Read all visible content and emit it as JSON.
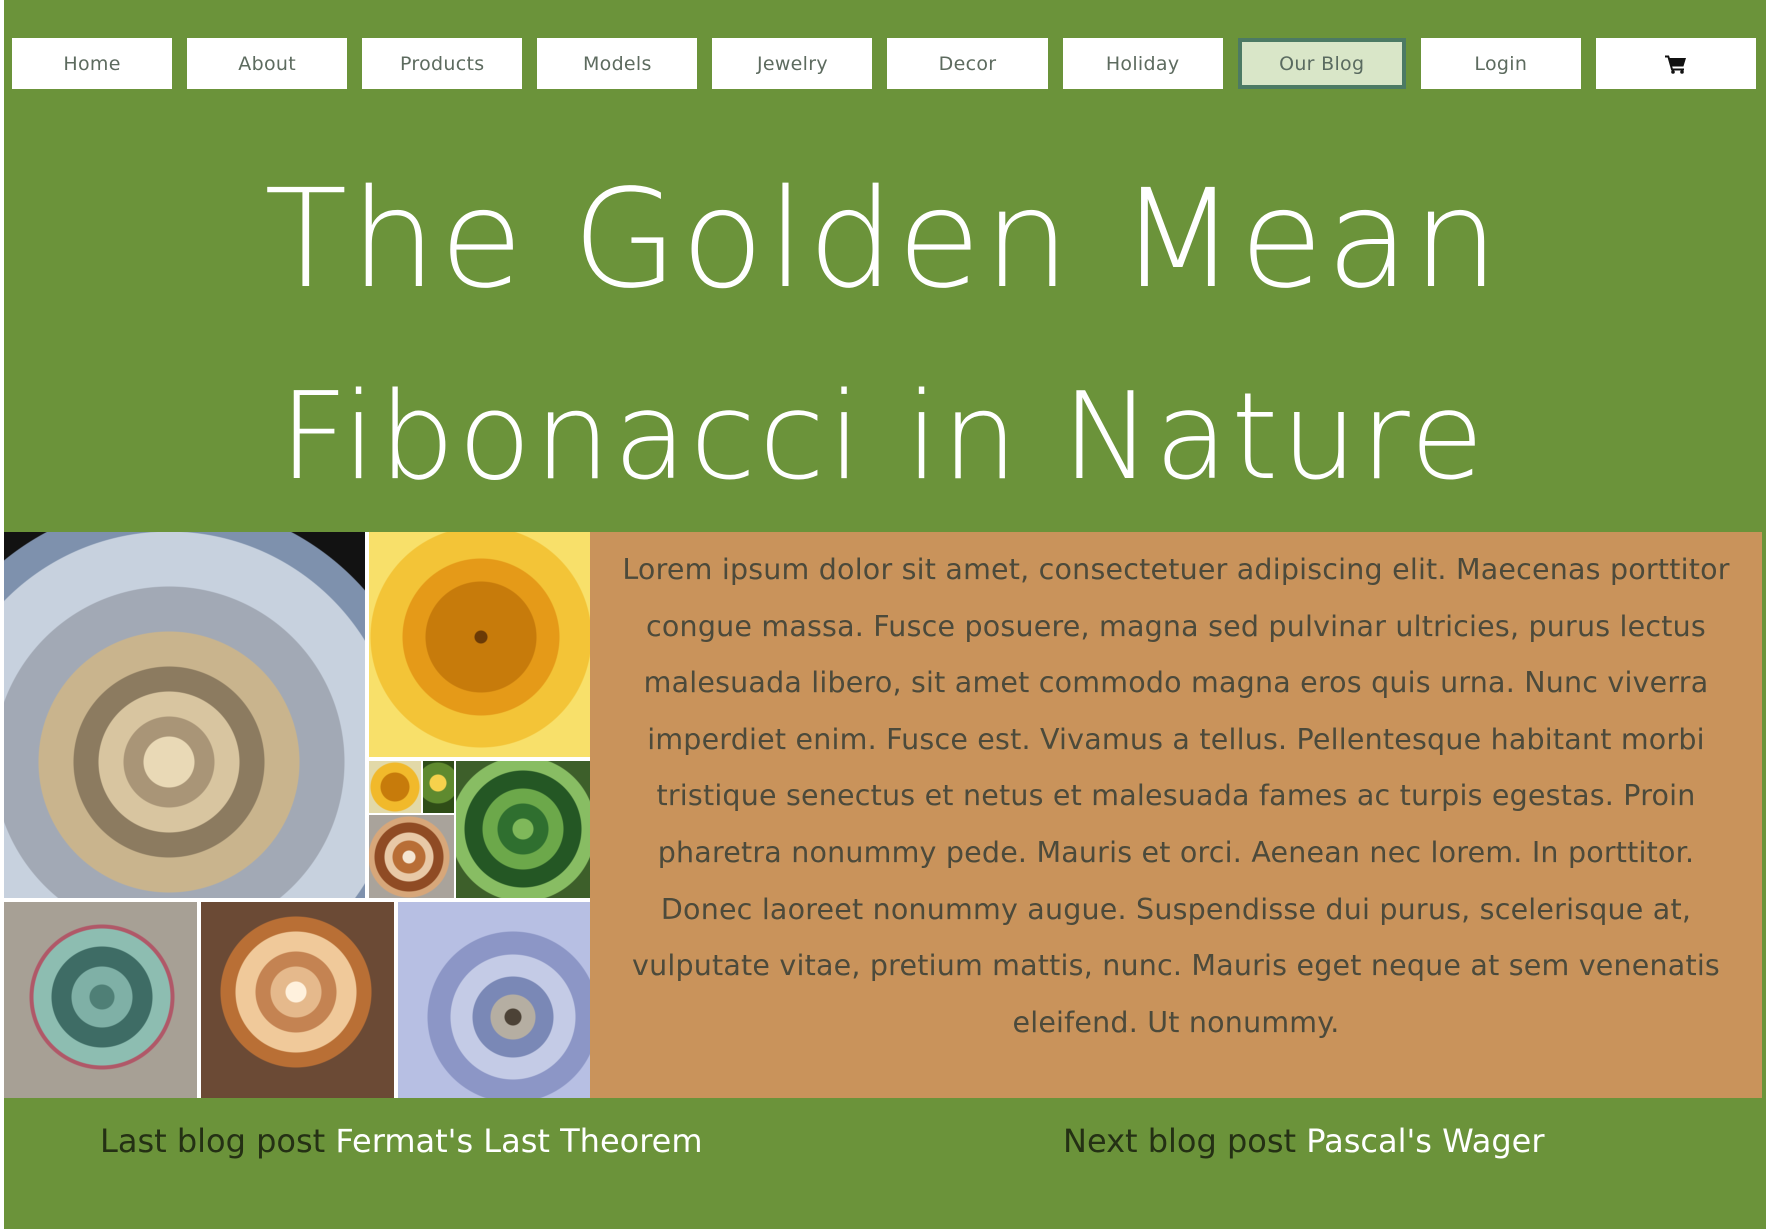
{
  "nav": {
    "items": [
      {
        "label": "Home"
      },
      {
        "label": "About"
      },
      {
        "label": "Products"
      },
      {
        "label": "Models"
      },
      {
        "label": "Jewelry"
      },
      {
        "label": "Decor"
      },
      {
        "label": "Holiday"
      },
      {
        "label": "Our Blog",
        "active": true
      },
      {
        "label": "Login"
      }
    ],
    "cart_icon": "shopping-cart-icon"
  },
  "hero": {
    "title": "The Golden Mean",
    "subtitle": "Fibonacci in Nature"
  },
  "gallery": {
    "images": [
      {
        "subject": "nautilus shell"
      },
      {
        "subject": "sunflower"
      },
      {
        "subject": "small sunflower"
      },
      {
        "subject": "small plant"
      },
      {
        "subject": "small snail shell"
      },
      {
        "subject": "spiral aloe"
      },
      {
        "subject": "succulent"
      },
      {
        "subject": "conch shell"
      },
      {
        "subject": "blue nautilus shell"
      }
    ]
  },
  "article": {
    "body": "Lorem ipsum dolor sit amet, consectetuer adipiscing elit. Maecenas porttitor congue massa. Fusce posuere, magna sed pulvinar ultricies, purus lectus malesuada libero, sit amet commodo magna eros quis urna. Nunc viverra imperdiet enim. Fusce est. Vivamus a tellus. Pellentesque habitant morbi tristique senectus et netus et malesuada fames ac turpis egestas. Proin pharetra nonummy pede. Mauris et orci. Aenean nec lorem. In porttitor. Donec laoreet nonummy augue. Suspendisse dui purus, scelerisque at, vulputate vitae, pretium mattis, nunc. Mauris eget neque at sem venenatis eleifend. Ut nonummy."
  },
  "post_nav": {
    "prev_label": "Last blog post",
    "prev_title": "Fermat's Last Theorem",
    "next_label": "Next blog post",
    "next_title": "Pascal's Wager"
  },
  "colors": {
    "page_bg": "#6b933a",
    "text_panel_bg": "#c9935b",
    "nav_active_bg": "#d9e6c8",
    "nav_active_border": "#4c7a64"
  }
}
